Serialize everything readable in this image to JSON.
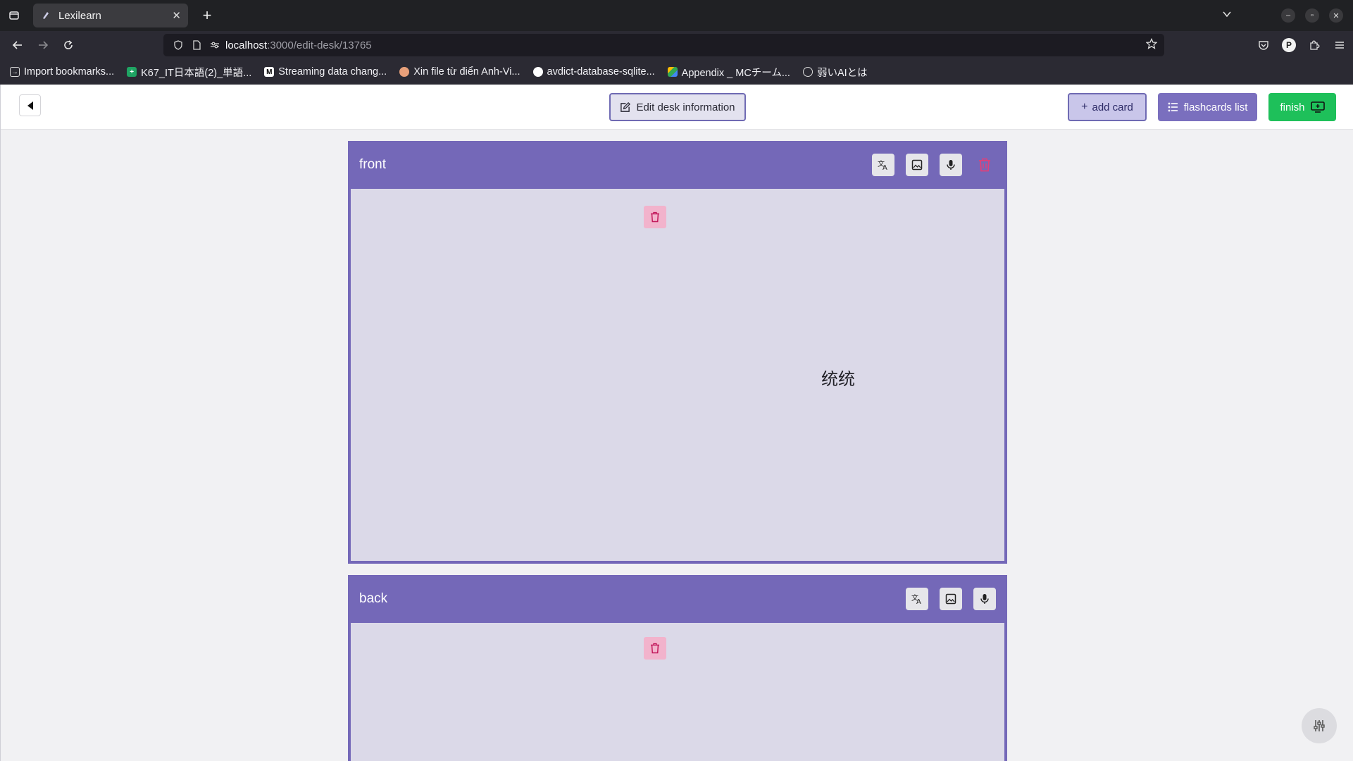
{
  "browser": {
    "tab_title": "Lexilearn",
    "url_host": "localhost",
    "url_path": ":3000/edit-desk/13765",
    "bookmarks": [
      {
        "label": "Import bookmarks..."
      },
      {
        "label": "K67_IT日本語(2)_単語..."
      },
      {
        "label": "Streaming data chang..."
      },
      {
        "label": "Xin file từ điển Anh-Vi..."
      },
      {
        "label": "avdict-database-sqlite..."
      },
      {
        "label": "Appendix _ MCチーム..."
      },
      {
        "label": "弱いAIとは"
      }
    ]
  },
  "header": {
    "edit_info_label": "Edit desk information",
    "add_card_label": "add card",
    "flashcards_list_label": "flashcards list",
    "finish_label": "finish"
  },
  "cards": {
    "front": {
      "label": "front",
      "text": "统统"
    },
    "back": {
      "label": "back",
      "text": ""
    }
  },
  "icons": {
    "translate": "translate-icon",
    "image": "image-icon",
    "mic": "microphone-icon",
    "trash": "trash-icon",
    "settings": "sliders-icon"
  },
  "colors": {
    "primary": "#7468b8",
    "success": "#1ec05a",
    "danger": "#e0407a"
  }
}
